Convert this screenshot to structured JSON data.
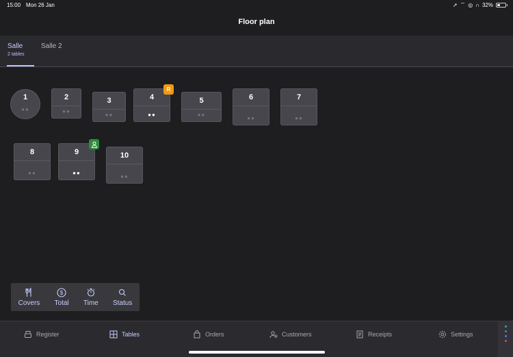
{
  "status": {
    "time": "15:00",
    "date": "Mon 26 Jan",
    "battery": "32%",
    "battery_level": 0.32
  },
  "header": {
    "title": "Floor plan"
  },
  "tabs": [
    {
      "label": "Salle",
      "sub": "2 tables",
      "active": true
    },
    {
      "label": "Salle 2",
      "sub": "",
      "active": false
    }
  ],
  "tables": [
    {
      "number": "1",
      "shape": "round",
      "dots": "●●",
      "occupied": false
    },
    {
      "number": "2",
      "shape": "square",
      "dots": "●●",
      "occupied": false
    },
    {
      "number": "3",
      "shape": "square",
      "dots": "●●",
      "occupied": false
    },
    {
      "number": "4",
      "shape": "square",
      "dots": "●●",
      "occupied": true,
      "badge": "R",
      "badge_color": "#f29a12"
    },
    {
      "number": "5",
      "shape": "square",
      "dots": "●●",
      "occupied": false
    },
    {
      "number": "6",
      "shape": "square",
      "dots": "●●",
      "occupied": false
    },
    {
      "number": "7",
      "shape": "square",
      "dots": "●●",
      "occupied": false
    },
    {
      "number": "8",
      "shape": "square",
      "dots": "●●",
      "occupied": false
    },
    {
      "number": "9",
      "shape": "square",
      "dots": "●●",
      "occupied": true,
      "badge_icon": "person-icon",
      "badge_color": "#2e8b3b"
    },
    {
      "number": "10",
      "shape": "square",
      "dots": "●●",
      "occupied": false
    }
  ],
  "filters": [
    {
      "label": "Covers",
      "icon": "cutlery-icon"
    },
    {
      "label": "Total",
      "icon": "dollar-icon"
    },
    {
      "label": "Time",
      "icon": "timer-icon"
    },
    {
      "label": "Status",
      "icon": "search-icon"
    }
  ],
  "nav": [
    {
      "label": "Register",
      "icon": "register-icon",
      "active": false
    },
    {
      "label": "Tables",
      "icon": "tables-icon",
      "active": true
    },
    {
      "label": "Orders",
      "icon": "bag-icon",
      "active": false
    },
    {
      "label": "Customers",
      "icon": "customers-icon",
      "active": false
    },
    {
      "label": "Receipts",
      "icon": "receipt-icon",
      "active": false
    },
    {
      "label": "Settings",
      "icon": "gear-icon",
      "active": false
    }
  ],
  "colors": {
    "accent": "#c7d0ff",
    "background": "#1e1e21",
    "table": "#47464c"
  }
}
